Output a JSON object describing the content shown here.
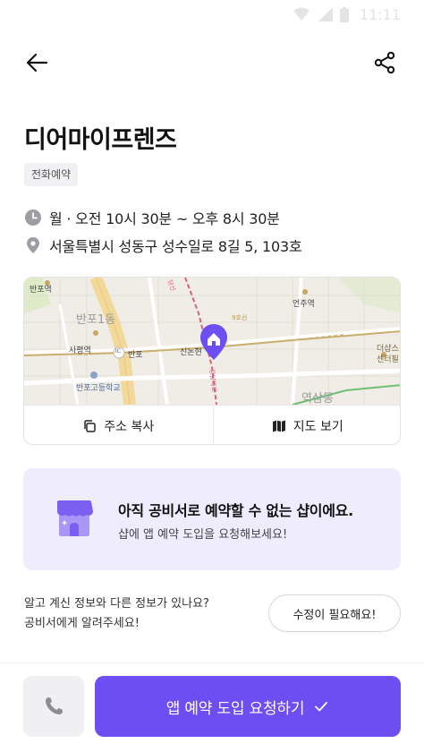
{
  "status_bar": {
    "time": "11:11"
  },
  "header": {
    "back_icon": "arrow-left-icon",
    "share_icon": "share-icon"
  },
  "shop": {
    "name": "디어마이프렌즈",
    "tag": "전화예약",
    "hours": "월 · 오전 10시 30분 ~ 오후 8시 30분",
    "address": "서울특별시 성동구 성수일로 8길 5, 103호"
  },
  "map": {
    "labels": {
      "banpo_station": "반포역",
      "banpo1dong": "반포1동",
      "sapyeong": "사평역",
      "banpo_ic": "반포",
      "ic": "IC",
      "school": "반포고등학교",
      "sinnonhyeon": "신논현",
      "eonju": "언주역",
      "yeoksam": "역삼동",
      "center": "더샵스\n센터필",
      "line9": "9호선",
      "gangnam": "강남대로",
      "dangsan": "당산"
    },
    "copy_label": "주소 복사",
    "map_label": "지도 보기"
  },
  "notice": {
    "title": "아직 공비서로 예약할 수 없는 샵이에요.",
    "subtitle": "샵에 앱 예약 도입을 요청해보세요!"
  },
  "report": {
    "line1": "알고 계신 정보와 다른 정보가 있나요?",
    "line2": "공비서에게 알려주세요!",
    "button": "수정이 필요해요!"
  },
  "bottom": {
    "cta": "앱 예약 도입 요청하기",
    "cta_color": "#6c4ef2"
  }
}
